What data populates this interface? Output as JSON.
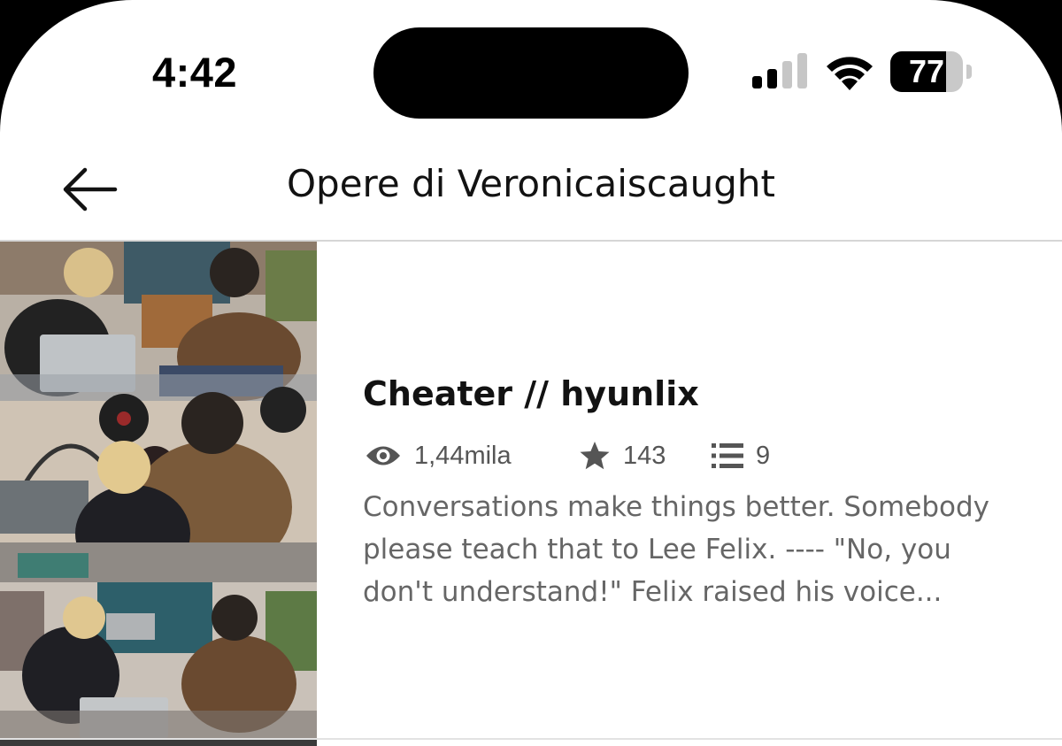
{
  "status_bar": {
    "time": "4:42",
    "battery": "77",
    "battery_level": 0.77,
    "signal_bars_active": 2
  },
  "header": {
    "title": "Opere di Veronicaiscaught",
    "back_icon": "arrow-left-icon"
  },
  "story": {
    "title": "Cheater // hyunlix",
    "reads": "1,44mila",
    "votes": "143",
    "parts": "9",
    "description": "Conversations make things better. Somebody please teach that to Lee Felix.  ---- \"No, you don't understand!\" Felix raised his voice...",
    "icons": {
      "reads": "eye-icon",
      "votes": "star-icon",
      "parts": "list-icon"
    }
  },
  "colors": {
    "title_text": "#121212",
    "meta_text": "#555555",
    "description_text": "#666666",
    "divider": "#d6d6d6"
  }
}
